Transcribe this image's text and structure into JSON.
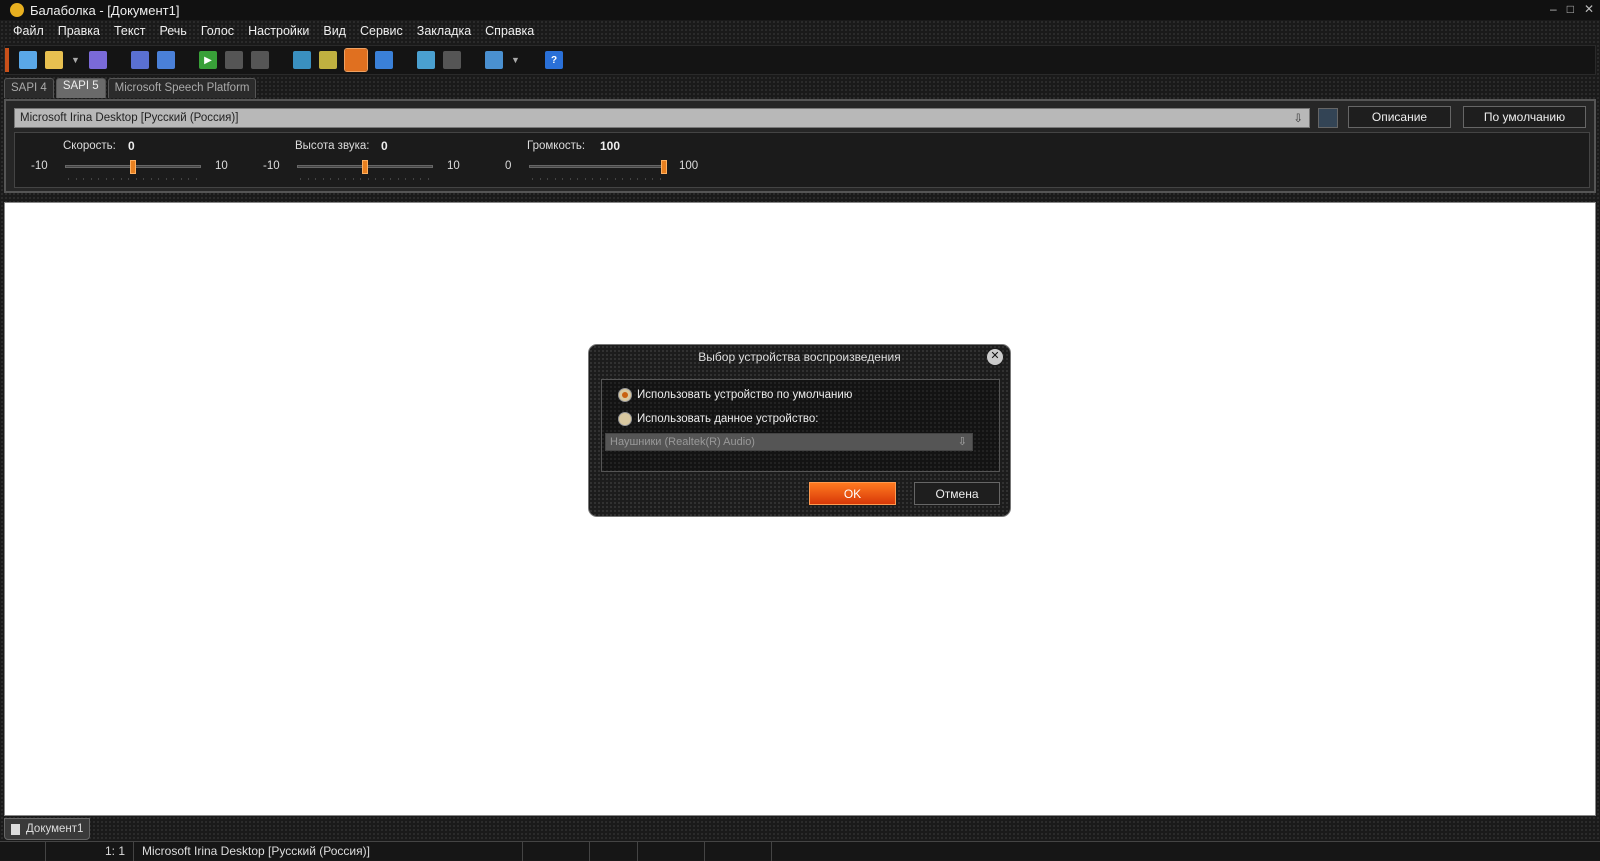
{
  "window": {
    "title": "Балаболка - [Документ1]",
    "controls": [
      "–",
      "□",
      "✕"
    ]
  },
  "menu": [
    "Файл",
    "Правка",
    "Текст",
    "Речь",
    "Голос",
    "Настройки",
    "Вид",
    "Сервис",
    "Закладка",
    "Справка"
  ],
  "toolbar": {
    "icons": [
      "new-document-icon",
      "open-folder-icon",
      "save-icon",
      "export-audio-icon",
      "batch-convert-icon",
      "play-icon",
      "pause-icon",
      "stop-icon",
      "read-clipboard-icon",
      "read-files-icon",
      "clipboard-monitor-icon",
      "dictionary-icon",
      "add-bookmark-icon",
      "remove-bookmark-icon",
      "split-icon",
      "help-icon"
    ],
    "help_glyph": "?"
  },
  "engine_tabs": [
    {
      "label": "SAPI 4",
      "active": false
    },
    {
      "label": "SAPI 5",
      "active": true
    },
    {
      "label": "Microsoft Speech Platform",
      "active": false
    }
  ],
  "voice": {
    "selected": "Microsoft Irina Desktop [Русский (Россия)]",
    "describe_label": "Описание",
    "default_label": "По умолчанию"
  },
  "sliders": [
    {
      "label": "Скорость:",
      "value": "0",
      "min": "-10",
      "max": "10",
      "fraction": 0.5
    },
    {
      "label": "Высота звука:",
      "value": "0",
      "min": "-10",
      "max": "10",
      "fraction": 0.5
    },
    {
      "label": "Громкость:",
      "value": "100",
      "min": "0",
      "max": "100",
      "fraction": 1.0
    }
  ],
  "document_tab": "Документ1",
  "status": {
    "position": "1:  1",
    "voice": "Microsoft Irina Desktop [Русский (Россия)]"
  },
  "dialog": {
    "title": "Выбор устройства воспроизведения",
    "option_default": "Использовать устройство по умолчанию",
    "option_device": "Использовать данное устройство:",
    "device": "Наушники (Realtek(R) Audio)",
    "ok": "OK",
    "cancel": "Отмена",
    "selected_option": "default"
  },
  "colors": {
    "accent": "#e07020",
    "background": "#1a1a1a",
    "editor": "#ffffff"
  }
}
